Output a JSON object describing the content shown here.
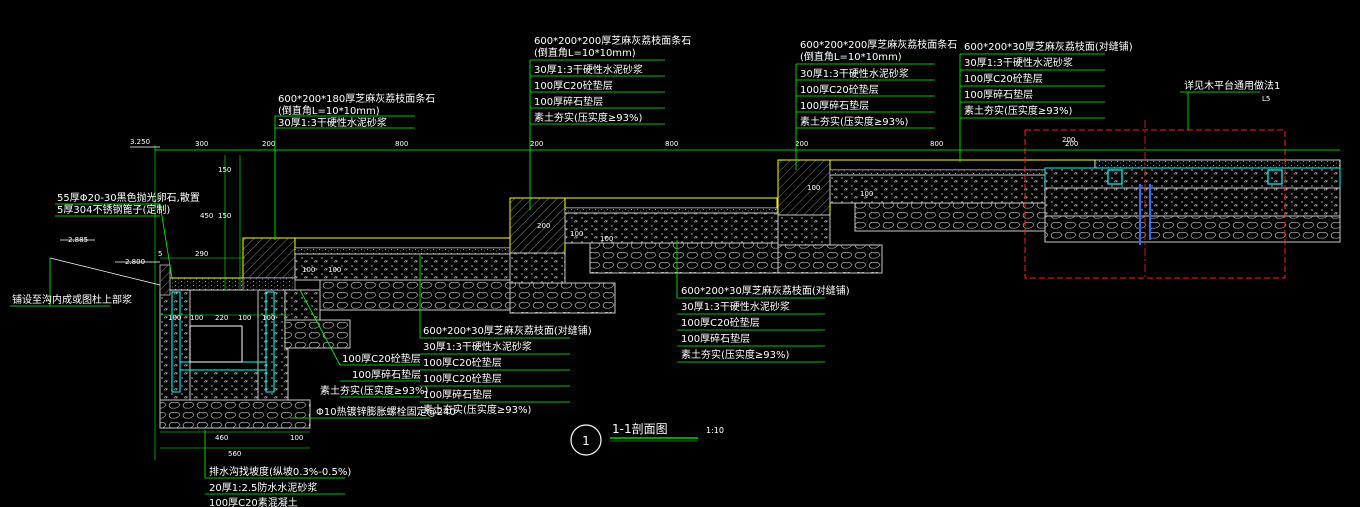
{
  "drawing": {
    "title": "1-1剖面图",
    "scale": "1:10",
    "detail_number": "1",
    "colors": {
      "background": "#000000",
      "leader": "#00ff00",
      "outline": "#ffff00",
      "fill": "#c8c8c8",
      "water": "#00ffff",
      "pipe": "#2f6bff",
      "red": "#ff2020",
      "white": "#ffffff"
    }
  },
  "elevations": {
    "e1": "3.250",
    "e2": "2.885",
    "e3": "2.800"
  },
  "dimensions": {
    "top": [
      "300",
      "200",
      "800",
      "200",
      "800",
      "200",
      "800",
      "200"
    ],
    "left_vertical": [
      "150",
      "450",
      "150"
    ],
    "left_small": [
      "5",
      "290",
      "100",
      "100",
      "220",
      "100",
      "100"
    ],
    "bottom": [
      "460",
      "100",
      "560"
    ],
    "misc": [
      "100",
      "100",
      "100",
      "100",
      "100",
      "200",
      "200",
      "100"
    ]
  },
  "callouts": {
    "c1": [
      "600*200*180厚芝麻灰荔枝面条石",
      "(倒直角L=10*10mm)",
      "30厚1:3干硬性水泥砂浆"
    ],
    "c2": [
      "600*200*200厚芝麻灰荔枝面条石",
      "(倒直角L=10*10mm)",
      "30厚1:3干硬性水泥砂浆",
      "100厚C20砼垫层",
      "100厚碎石垫层",
      "素土夯实(压实度≥93%)"
    ],
    "c3": [
      "600*200*200厚芝麻灰荔枝面条石",
      "(倒直角L=10*10mm)",
      "30厚1:3干硬性水泥砂浆",
      "100厚C20砼垫层",
      "100厚碎石垫层",
      "素土夯实(压实度≥93%)"
    ],
    "c4": [
      "600*200*30厚芝麻灰荔枝面(对缝铺)",
      "30厚1:3干硬性水泥砂浆",
      "100厚C20砼垫层",
      "100厚碎石垫层",
      "素土夯实(压实度≥93%)"
    ],
    "c5": [
      "详见木平台通用做法1",
      "L5"
    ],
    "c6": [
      "55厚Φ20-30黑色抛光卵石,散置",
      "5厚304不锈钢篦子(定制)"
    ],
    "c7": [
      "铺设至沟内成或图杜上部浆"
    ],
    "c8": [
      "600*200*30厚芝麻灰荔枝面(对缝铺)",
      "30厚1:3干硬性水泥砂浆",
      "100厚C20砼垫层",
      "100厚碎石垫层",
      "素土夯实(压实度≥93%)"
    ],
    "c9": [
      "600*200*30厚芝麻灰荔枝面(对缝铺)",
      "30厚1:3干硬性水泥砂浆",
      "100厚C20砼垫层",
      "100厚C20砼垫层",
      "100厚碎石垫层",
      "素土夯实(压实度≥93%)"
    ],
    "c10": [
      "100厚C20砼垫层",
      "100厚碎石垫层",
      "素土夯实(压实度≥93%)"
    ],
    "c11": [
      "Φ10热镀锌膨胀螺栓固定@240"
    ],
    "c12": [
      "排水沟找坡度(纵坡0.3%-0.5%)",
      "20厚1:2.5防水水泥砂浆",
      "100厚C20素混凝土"
    ]
  }
}
